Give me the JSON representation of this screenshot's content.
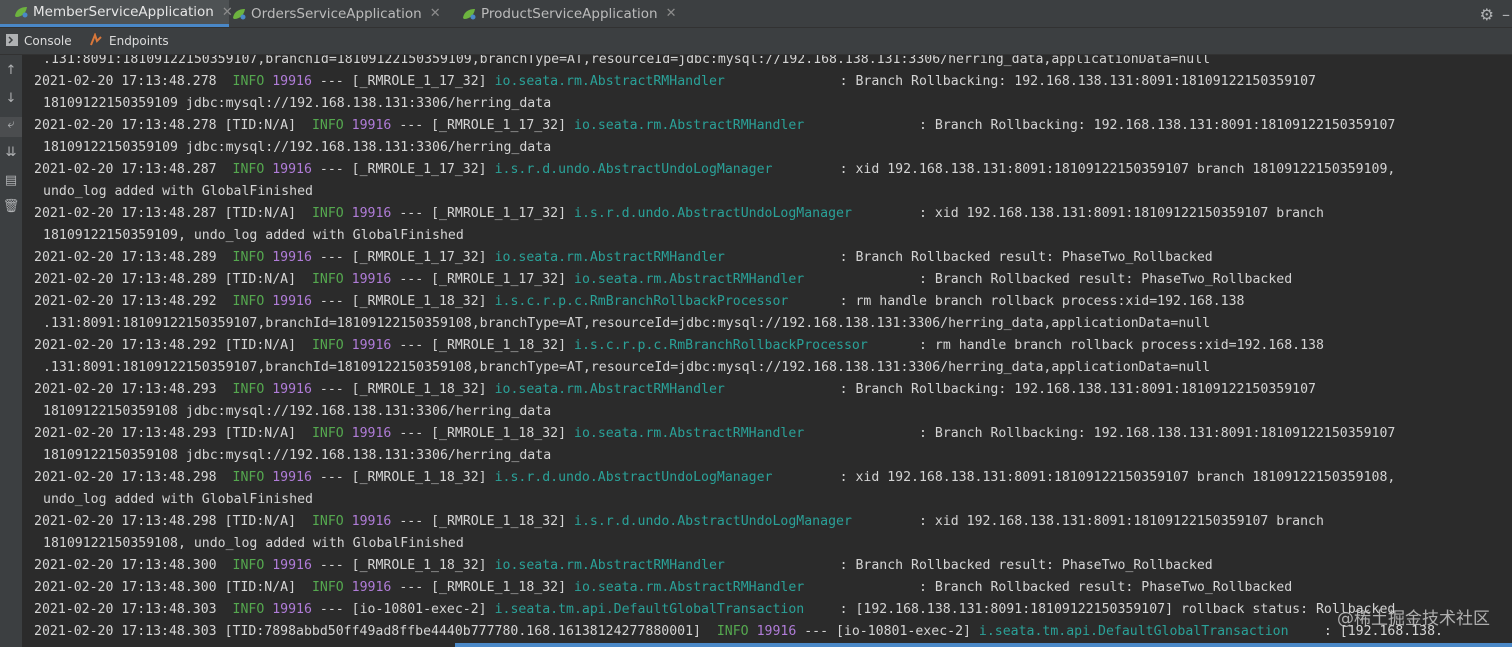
{
  "tabs": [
    {
      "label": "MemberServiceApplication",
      "active": true
    },
    {
      "label": "OrdersServiceApplication",
      "active": false
    },
    {
      "label": "ProductServiceApplication",
      "active": false
    }
  ],
  "subtabs": {
    "console": "Console",
    "endpoints": "Endpoints"
  },
  "watermark": "@稀土掘金技术社区",
  "console_lines": [
    {
      "text": ".131:8091:18109122150359107,branchId=18109122150359109,branchType=AT,resourceId=jdbc:mysql://192.168.138.131:3306/herring_data,applicationData=null"
    },
    {
      "date": "2021-02-20 17:13:48.278",
      "tid": "",
      "level": "INFO",
      "pid": "19916",
      "thread": "--- [_RMROLE_1_17_32]",
      "logger": "io.seata.rm.AbstractRMHandler",
      "msg": ": Branch Rollbacking: 192.168.138.131:8091:18109122150359107"
    },
    {
      "text": "18109122150359109 jdbc:mysql://192.168.138.131:3306/herring_data"
    },
    {
      "date": "2021-02-20 17:13:48.278",
      "tid": "[TID:N/A]",
      "level": "INFO",
      "pid": "19916",
      "thread": "--- [_RMROLE_1_17_32]",
      "logger": "io.seata.rm.AbstractRMHandler",
      "msg": ": Branch Rollbacking: 192.168.138.131:8091:18109122150359107"
    },
    {
      "text": "18109122150359109 jdbc:mysql://192.168.138.131:3306/herring_data"
    },
    {
      "date": "2021-02-20 17:13:48.287",
      "tid": "",
      "level": "INFO",
      "pid": "19916",
      "thread": "--- [_RMROLE_1_17_32]",
      "logger": "i.s.r.d.undo.AbstractUndoLogManager",
      "msg": ": xid 192.168.138.131:8091:18109122150359107 branch 18109122150359109,"
    },
    {
      "text": "undo_log added with GlobalFinished"
    },
    {
      "date": "2021-02-20 17:13:48.287",
      "tid": "[TID:N/A]",
      "level": "INFO",
      "pid": "19916",
      "thread": "--- [_RMROLE_1_17_32]",
      "logger": "i.s.r.d.undo.AbstractUndoLogManager",
      "msg": ": xid 192.168.138.131:8091:18109122150359107 branch"
    },
    {
      "text": "18109122150359109, undo_log added with GlobalFinished"
    },
    {
      "date": "2021-02-20 17:13:48.289",
      "tid": "",
      "level": "INFO",
      "pid": "19916",
      "thread": "--- [_RMROLE_1_17_32]",
      "logger": "io.seata.rm.AbstractRMHandler",
      "msg": ": Branch Rollbacked result: PhaseTwo_Rollbacked"
    },
    {
      "date": "2021-02-20 17:13:48.289",
      "tid": "[TID:N/A]",
      "level": "INFO",
      "pid": "19916",
      "thread": "--- [_RMROLE_1_17_32]",
      "logger": "io.seata.rm.AbstractRMHandler",
      "msg": ": Branch Rollbacked result: PhaseTwo_Rollbacked"
    },
    {
      "date": "2021-02-20 17:13:48.292",
      "tid": "",
      "level": "INFO",
      "pid": "19916",
      "thread": "--- [_RMROLE_1_18_32]",
      "logger": "i.s.c.r.p.c.RmBranchRollbackProcessor",
      "msg": ": rm handle branch rollback process:xid=192.168.138"
    },
    {
      "text": ".131:8091:18109122150359107,branchId=18109122150359108,branchType=AT,resourceId=jdbc:mysql://192.168.138.131:3306/herring_data,applicationData=null"
    },
    {
      "date": "2021-02-20 17:13:48.292",
      "tid": "[TID:N/A]",
      "level": "INFO",
      "pid": "19916",
      "thread": "--- [_RMROLE_1_18_32]",
      "logger": "i.s.c.r.p.c.RmBranchRollbackProcessor",
      "msg": ": rm handle branch rollback process:xid=192.168.138"
    },
    {
      "text": ".131:8091:18109122150359107,branchId=18109122150359108,branchType=AT,resourceId=jdbc:mysql://192.168.138.131:3306/herring_data,applicationData=null"
    },
    {
      "date": "2021-02-20 17:13:48.293",
      "tid": "",
      "level": "INFO",
      "pid": "19916",
      "thread": "--- [_RMROLE_1_18_32]",
      "logger": "io.seata.rm.AbstractRMHandler",
      "msg": ": Branch Rollbacking: 192.168.138.131:8091:18109122150359107"
    },
    {
      "text": "18109122150359108 jdbc:mysql://192.168.138.131:3306/herring_data"
    },
    {
      "date": "2021-02-20 17:13:48.293",
      "tid": "[TID:N/A]",
      "level": "INFO",
      "pid": "19916",
      "thread": "--- [_RMROLE_1_18_32]",
      "logger": "io.seata.rm.AbstractRMHandler",
      "msg": ": Branch Rollbacking: 192.168.138.131:8091:18109122150359107"
    },
    {
      "text": "18109122150359108 jdbc:mysql://192.168.138.131:3306/herring_data"
    },
    {
      "date": "2021-02-20 17:13:48.298",
      "tid": "",
      "level": "INFO",
      "pid": "19916",
      "thread": "--- [_RMROLE_1_18_32]",
      "logger": "i.s.r.d.undo.AbstractUndoLogManager",
      "msg": ": xid 192.168.138.131:8091:18109122150359107 branch 18109122150359108,"
    },
    {
      "text": "undo_log added with GlobalFinished"
    },
    {
      "date": "2021-02-20 17:13:48.298",
      "tid": "[TID:N/A]",
      "level": "INFO",
      "pid": "19916",
      "thread": "--- [_RMROLE_1_18_32]",
      "logger": "i.s.r.d.undo.AbstractUndoLogManager",
      "msg": ": xid 192.168.138.131:8091:18109122150359107 branch"
    },
    {
      "text": "18109122150359108, undo_log added with GlobalFinished"
    },
    {
      "date": "2021-02-20 17:13:48.300",
      "tid": "",
      "level": "INFO",
      "pid": "19916",
      "thread": "--- [_RMROLE_1_18_32]",
      "logger": "io.seata.rm.AbstractRMHandler",
      "msg": ": Branch Rollbacked result: PhaseTwo_Rollbacked"
    },
    {
      "date": "2021-02-20 17:13:48.300",
      "tid": "[TID:N/A]",
      "level": "INFO",
      "pid": "19916",
      "thread": "--- [_RMROLE_1_18_32]",
      "logger": "io.seata.rm.AbstractRMHandler",
      "msg": ": Branch Rollbacked result: PhaseTwo_Rollbacked"
    },
    {
      "date": "2021-02-20 17:13:48.303",
      "tid": "",
      "level": "INFO",
      "pid": "19916",
      "thread": "--- [io-10801-exec-2]",
      "logger": "i.seata.tm.api.DefaultGlobalTransaction",
      "msg": ": [192.168.138.131:8091:18109122150359107] rollback status: Rollbacked"
    },
    {
      "date": "2021-02-20 17:13:48.303",
      "tid": "[TID:7898abbd50ff49ad8ffbe4440b777780.168.16138124277880001]",
      "level": "INFO",
      "pid": "19916",
      "thread": "--- [io-10801-exec-2]",
      "logger": "i.seata.tm.api.DefaultGlobalTransaction",
      "msg": ": [192.168.138."
    }
  ]
}
